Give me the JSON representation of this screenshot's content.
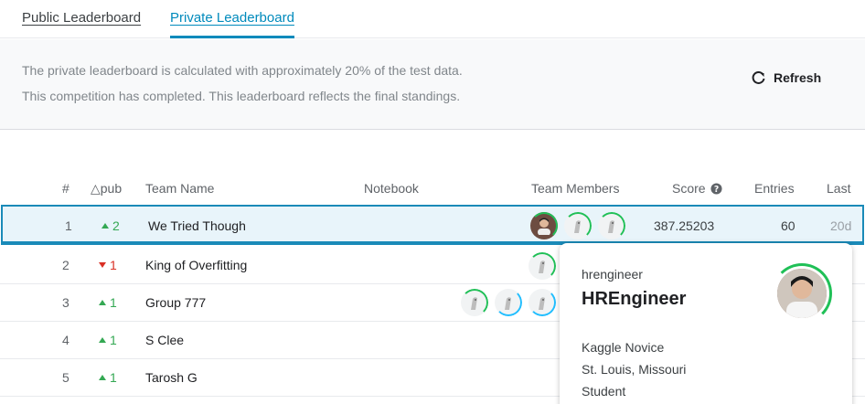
{
  "tabs": {
    "public": "Public Leaderboard",
    "private": "Private Leaderboard"
  },
  "notice": {
    "line1": "The private leaderboard is calculated with approximately 20% of the test data.",
    "line2": "This competition has completed. This leaderboard reflects the final standings."
  },
  "refresh_label": "Refresh",
  "columns": {
    "rank": "#",
    "delta": "△pub",
    "team": "Team Name",
    "notebook": "Notebook",
    "members": "Team Members",
    "score": "Score",
    "entries": "Entries",
    "last": "Last"
  },
  "rows": [
    {
      "rank": "1",
      "delta": "2",
      "direction": "up",
      "team": "We Tried Though",
      "score": "387.25203",
      "entries": "60",
      "last": "20d"
    },
    {
      "rank": "2",
      "delta": "1",
      "direction": "down",
      "team": "King of Overfitting"
    },
    {
      "rank": "3",
      "delta": "1",
      "direction": "up",
      "team": "Group 777"
    },
    {
      "rank": "4",
      "delta": "1",
      "direction": "up",
      "team": "S Clee"
    },
    {
      "rank": "5",
      "delta": "1",
      "direction": "up",
      "team": "Tarosh G"
    }
  ],
  "popup": {
    "handle": "hrengineer",
    "name": "HREngineer",
    "tier": "Kaggle Novice",
    "location": "St. Louis, Missouri",
    "occupation": "Student"
  },
  "colors": {
    "accent": "#008abc",
    "up": "#34a853",
    "down": "#d93025",
    "ring_green": "#20c057"
  },
  "icons": {
    "refresh": "refresh-icon",
    "help": "help-circle-icon",
    "default_avatar": "kaggle-penguin-avatar"
  }
}
